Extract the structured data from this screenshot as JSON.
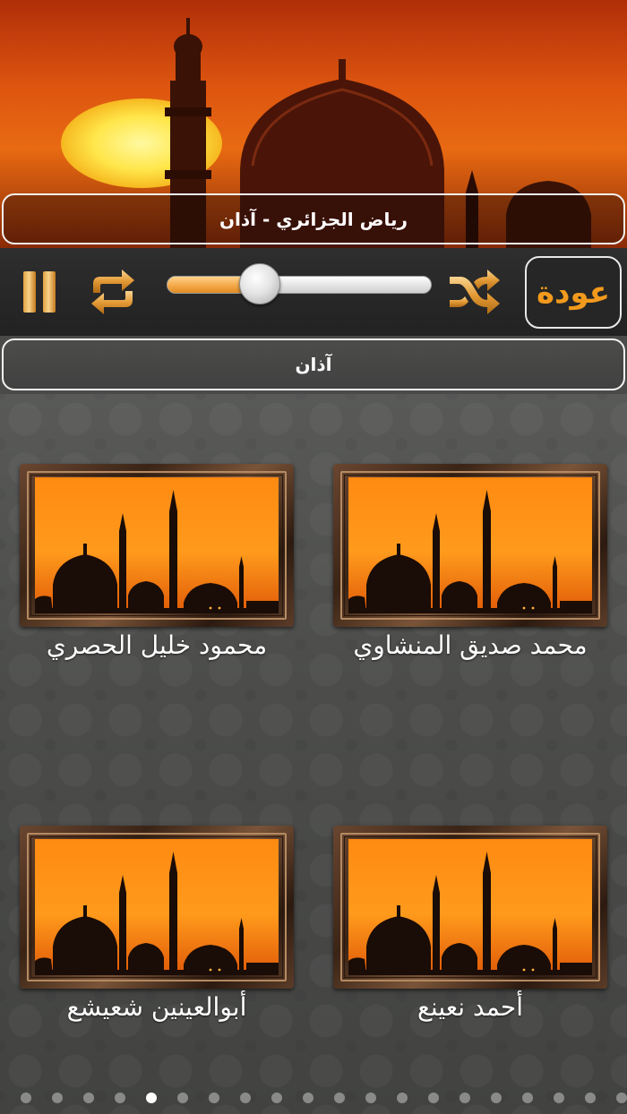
{
  "now_playing": {
    "title": "رياض الجزائري - آذان"
  },
  "player": {
    "back_label": "عودة",
    "progress": 0.35,
    "icons": {
      "pause": "pause-icon",
      "repeat": "repeat-icon",
      "shuffle": "shuffle-icon"
    },
    "accent_color": "#f29a1d"
  },
  "category": {
    "title": "آذان"
  },
  "reciters": [
    {
      "name": "محمد صديق المنشاوي"
    },
    {
      "name": "محمود خليل الحصري"
    },
    {
      "name": "أحمد نعينع"
    },
    {
      "name": "أبوالعينين شعيشع"
    }
  ],
  "pagination": {
    "total": 20,
    "current": 4
  }
}
